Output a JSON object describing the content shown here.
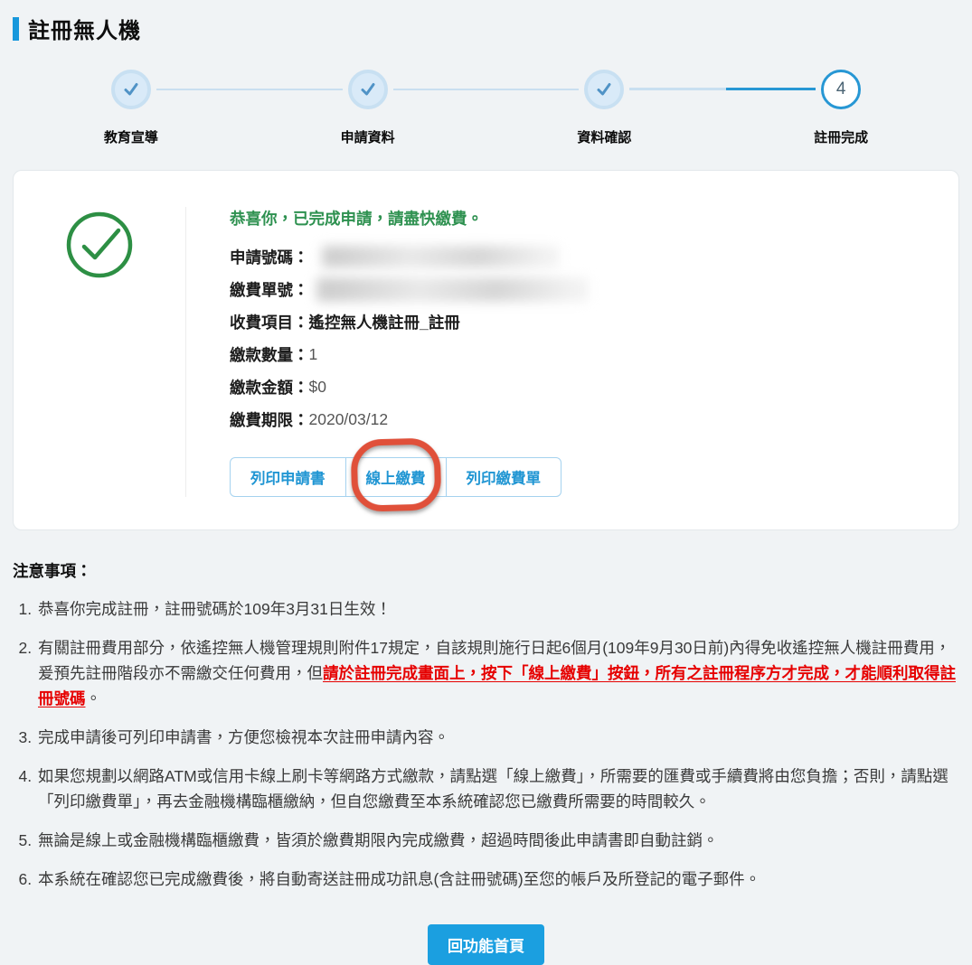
{
  "page": {
    "title": "註冊無人機"
  },
  "stepper": {
    "steps": [
      {
        "label": "教育宣導",
        "state": "done"
      },
      {
        "label": "申請資料",
        "state": "done"
      },
      {
        "label": "資料確認",
        "state": "done"
      },
      {
        "label": "註冊完成",
        "state": "active",
        "number": "4"
      }
    ]
  },
  "result_card": {
    "heading": "恭喜你，已完成申請，請盡快繳費。",
    "fields": [
      {
        "label": "申請號碼：",
        "value": "",
        "redacted": true
      },
      {
        "label": "繳費單號：",
        "value": "",
        "redacted": true
      },
      {
        "label": "收費項目：",
        "value": "遙控無人機註冊_註冊"
      },
      {
        "label": "繳款數量：",
        "value": "1"
      },
      {
        "label": "繳款金額：",
        "value": "$0"
      },
      {
        "label": "繳費期限：",
        "value": "2020/03/12"
      }
    ],
    "buttons": [
      "列印申請書",
      "線上繳費",
      "列印繳費單"
    ]
  },
  "notes": {
    "heading": "注意事項：",
    "items": [
      {
        "text": "恭喜你完成註冊，註冊號碼於109年3月31日生效！"
      },
      {
        "pre": "有關註冊費用部分，依遙控無人機管理規則附件17規定，自該規則施行日起6個月(109年9月30日前)內得免收遙控無人機註冊費用，爰預先註冊階段亦不需繳交任何費用，但",
        "alert": "請於註冊完成畫面上，按下「線上繳費」按鈕，所有之註冊程序方才完成，才能順利取得註冊號碼",
        "post": "。"
      },
      {
        "text": "完成申請後可列印申請書，方便您檢視本次註冊申請內容。"
      },
      {
        "text": "如果您規劃以網路ATM或信用卡線上刷卡等網路方式繳款，請點選「線上繳費」，所需要的匯費或手續費將由您負擔；否則，請點選「列印繳費單」，再去金融機構臨櫃繳納，但自您繳費至本系統確認您已繳費所需要的時間較久。"
      },
      {
        "text": "無論是線上或金融機構臨櫃繳費，皆須於繳費期限內完成繳費，超過時間後此申請書即自動註銷。"
      },
      {
        "text": "本系統在確認您已完成繳費後，將自動寄送註冊成功訊息(含註冊號碼)至您的帳戶及所登記的電子郵件。"
      }
    ]
  },
  "footer": {
    "home_button": "回功能首頁"
  },
  "colors": {
    "accent_blue": "#1898dc",
    "step_active_blue": "#2797d4",
    "success_green": "#2e9150",
    "alert_red": "#e60000",
    "annotation_red": "#e0503a",
    "button_blue_text": "#2196d3",
    "home_button_blue": "#1b9fe0"
  }
}
